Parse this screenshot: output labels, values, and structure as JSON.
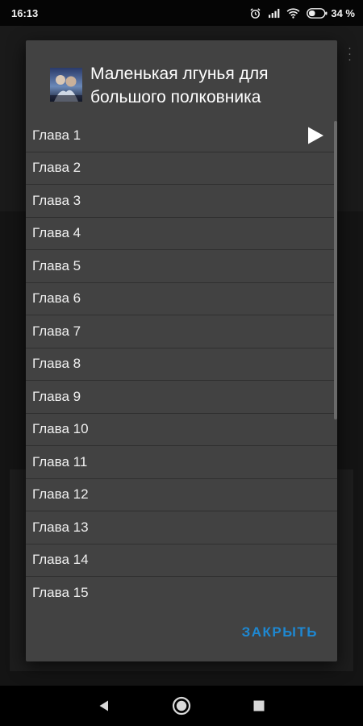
{
  "status_bar": {
    "time": "16:13",
    "battery_percent": "34 %",
    "icons": [
      "alarm-icon",
      "signal-icon",
      "wifi-icon",
      "battery-icon"
    ]
  },
  "dialog": {
    "title": "Маленькая лгунья для большого полковника",
    "chapters": [
      "Глава 1",
      "Глава 2",
      "Глава 3",
      "Глава 4",
      "Глава 5",
      "Глава 6",
      "Глава 7",
      "Глава 8",
      "Глава 9",
      "Глава 10",
      "Глава 11",
      "Глава 12",
      "Глава 13",
      "Глава 14",
      "Глава 15"
    ],
    "close_label": "ЗАКРЫТЬ",
    "current_chapter_icon": "play-icon"
  },
  "colors": {
    "dialog_background": "#424242",
    "accent": "#1e88d2",
    "text": "#f0f0f0"
  },
  "nav_bar": {
    "icons": [
      "back-icon",
      "home-icon",
      "recents-icon"
    ]
  }
}
